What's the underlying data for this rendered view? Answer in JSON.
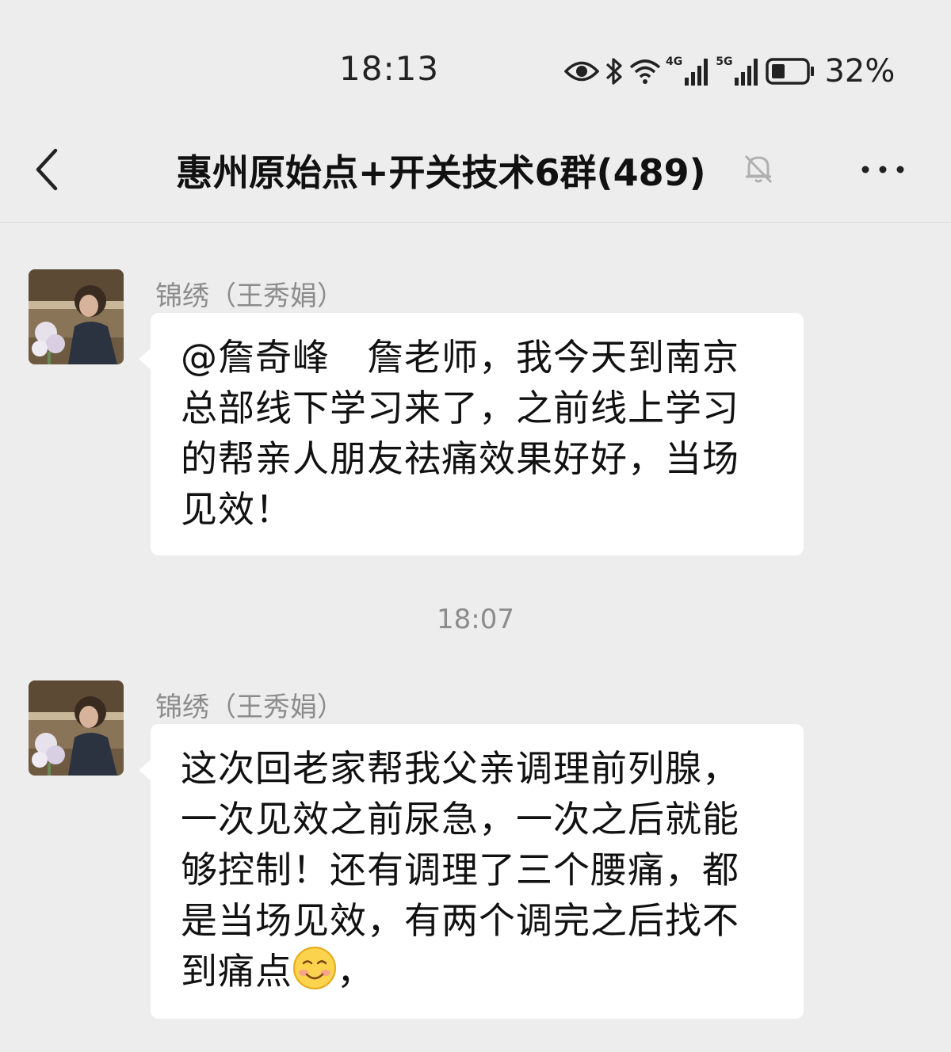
{
  "status_bar": {
    "time": "18:13",
    "network1": "4G",
    "network2": "5G",
    "battery": "32%",
    "icons": [
      "eye-icon",
      "bluetooth-icon",
      "wifi-icon",
      "signal-4g-icon",
      "signal-5g-icon",
      "battery-icon"
    ]
  },
  "nav": {
    "title": "惠州原始点+开关技术6群(489)",
    "back_icon": "chevron-left-icon",
    "mute_icon": "bell-muted-icon",
    "more_icon": "more-dots-icon"
  },
  "messages": [
    {
      "sender": "锦绣（王秀娟）",
      "text": "@詹奇峰　詹老师，我今天到南京总部线下学习来了，之前线上学习的帮亲人朋友祛痛效果好好，当场见效！"
    },
    {
      "sender": "锦绣（王秀娟）",
      "text": "这次回老家帮我父亲调理前列腺，一次见效之前尿急，一次之后就能够控制！还有调理了三个腰痛，都是当场见效，有两个调完之后找不到痛点",
      "text_suffix": "，"
    }
  ],
  "time_divider": "18:07",
  "colors": {
    "background": "#ededed",
    "bubble": "#ffffff",
    "sender_name": "#8c8c8c"
  }
}
